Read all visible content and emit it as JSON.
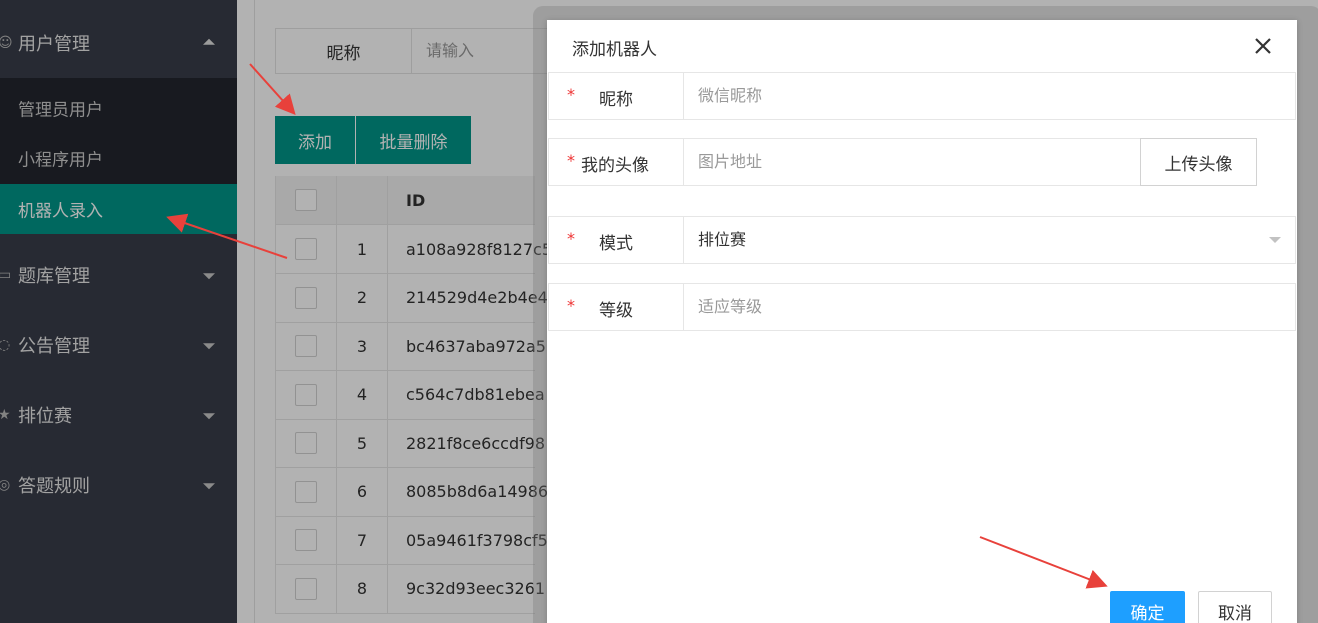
{
  "sidebar": {
    "groups": [
      {
        "label": "用户管理",
        "icon": "users-icon",
        "expanded": true
      },
      {
        "label": "题库管理",
        "icon": "book-icon",
        "expanded": false
      },
      {
        "label": "公告管理",
        "icon": "bell-icon",
        "expanded": false
      },
      {
        "label": "排位赛",
        "icon": "star-icon",
        "expanded": false
      },
      {
        "label": "答题规则",
        "icon": "rules-icon",
        "expanded": false
      }
    ],
    "submenu": [
      {
        "label": "管理员用户",
        "active": false
      },
      {
        "label": "小程序用户",
        "active": false
      },
      {
        "label": "机器人录入",
        "active": true
      }
    ]
  },
  "search": {
    "label": "昵称",
    "placeholder": "请输入"
  },
  "toolbar": {
    "add_label": "添加",
    "batch_delete_label": "批量删除"
  },
  "table": {
    "header_id": "ID",
    "rows": [
      {
        "num": "1",
        "id": "a108a928f8127c5"
      },
      {
        "num": "2",
        "id": "214529d4e2b4e4"
      },
      {
        "num": "3",
        "id": "bc4637aba972a5"
      },
      {
        "num": "4",
        "id": "c564c7db81ebea"
      },
      {
        "num": "5",
        "id": "2821f8ce6ccdf98"
      },
      {
        "num": "6",
        "id": "8085b8d6a14986"
      },
      {
        "num": "7",
        "id": "05a9461f3798cf5"
      },
      {
        "num": "8",
        "id": "9c32d93eec3261"
      }
    ]
  },
  "dialog": {
    "title": "添加机器人",
    "fields": {
      "nickname": {
        "label": "昵称",
        "placeholder": "微信昵称"
      },
      "avatar": {
        "label": "我的头像",
        "placeholder": "图片地址",
        "upload_label": "上传头像"
      },
      "mode": {
        "label": "模式",
        "value": "排位赛"
      },
      "level": {
        "label": "等级",
        "placeholder": "适应等级"
      }
    },
    "ok_label": "确定",
    "cancel_label": "取消"
  },
  "colors": {
    "sidebar_bg": "#393d49",
    "submenu_bg": "#23262e",
    "accent": "#009688",
    "primary_button": "#1e9fff",
    "required_star": "#ee3333",
    "annotation_arrow": "#e8413b"
  }
}
